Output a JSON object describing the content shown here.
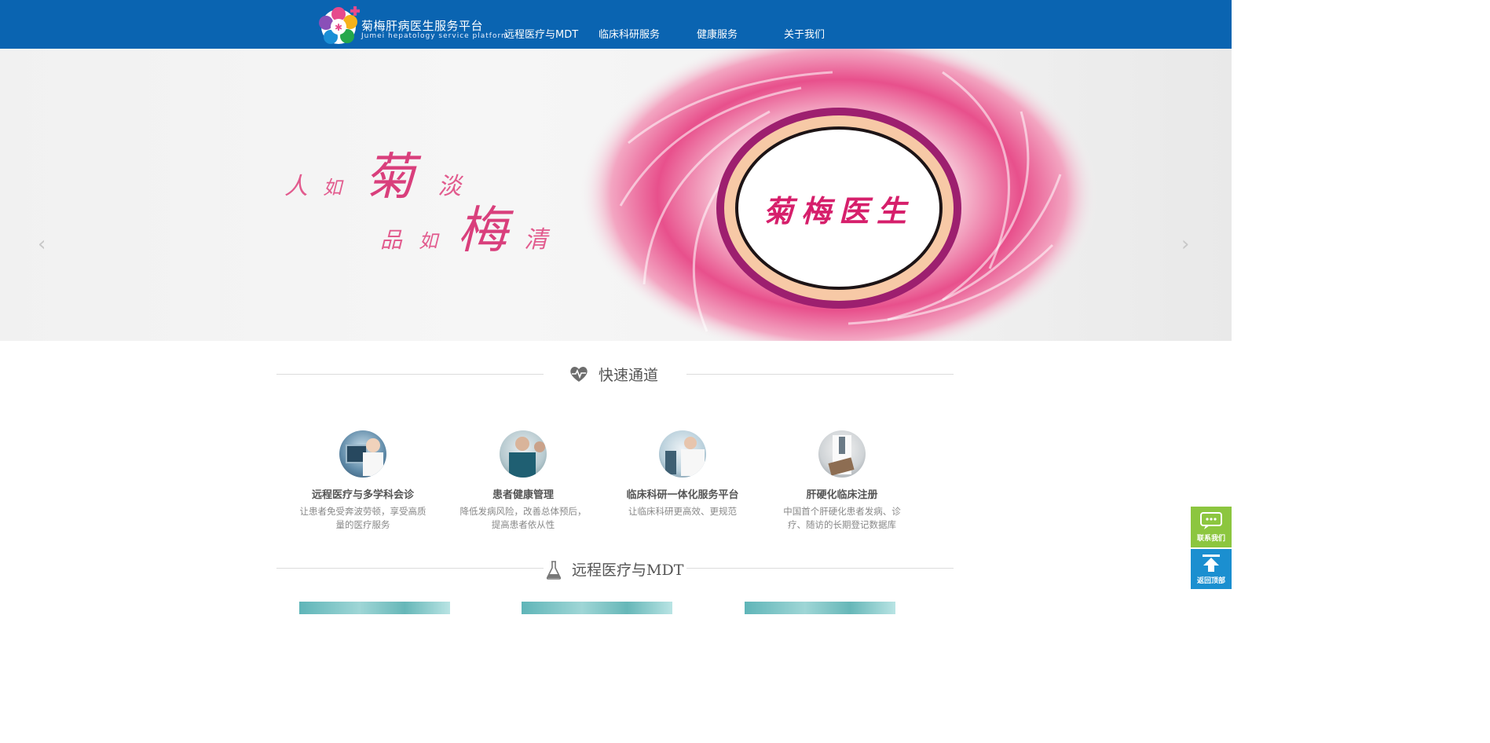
{
  "header": {
    "brand_cn": "菊梅肝病医生服务平台",
    "brand_en": "Jumei hepatology service platform",
    "nav": [
      "远程医疗与MDT",
      "临床科研服务",
      "健康服务",
      "关于我们"
    ],
    "bg_color": "#0a64b1"
  },
  "banner": {
    "line1": [
      "人",
      "如",
      "菊",
      "淡"
    ],
    "line2": [
      "品",
      "如",
      "梅",
      "清"
    ],
    "badge_text": "菊梅医生",
    "prev_arrow": "‹",
    "next_arrow": "›"
  },
  "quick": {
    "title": "快速通道",
    "cards": [
      {
        "title": "远程医疗与多学科会诊",
        "desc": "让患者免受奔波劳顿，享受高质量的医疗服务",
        "icon": "doctors-screen-photo"
      },
      {
        "title": "患者健康管理",
        "desc": "降低发病风险，改善总体预后，提高患者依从性",
        "icon": "nurses-photo"
      },
      {
        "title": "临床科研一体化服务平台",
        "desc": "让临床科研更高效、更规范",
        "icon": "lab-microscope-photo"
      },
      {
        "title": "肝硬化临床注册",
        "desc": "中国首个肝硬化患者发病、诊疗、随访的长期登记数据库",
        "icon": "doctor-clipboard-photo"
      }
    ]
  },
  "mdt": {
    "title": "远程医疗与MDT"
  },
  "float": {
    "contact": "联系我们",
    "top": "返回顶部",
    "contact_color": "#8cc63f",
    "top_color": "#1b8fd0"
  }
}
